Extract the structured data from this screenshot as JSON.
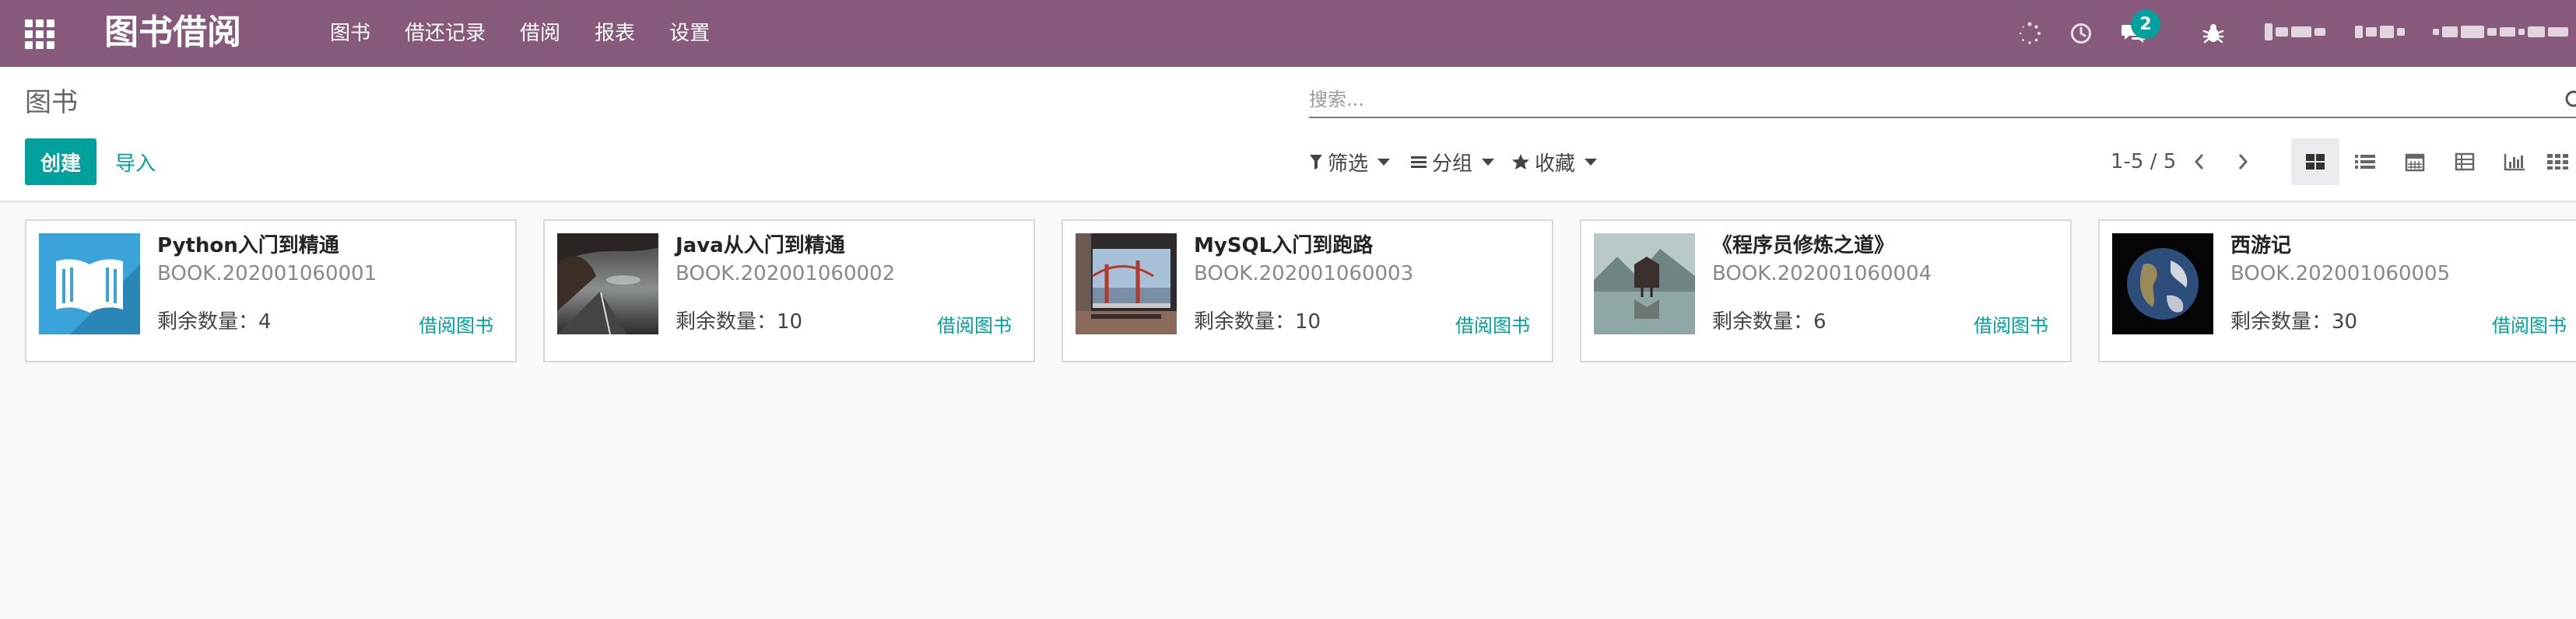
{
  "app": {
    "title": "图书借阅"
  },
  "menu": [
    "图书",
    "借还记录",
    "借阅",
    "报表",
    "设置"
  ],
  "systray": {
    "message_count": "2"
  },
  "breadcrumb": "图书",
  "buttons": {
    "create": "创建",
    "import": "导入"
  },
  "search": {
    "placeholder": "搜索..."
  },
  "filters": {
    "filter": "筛选",
    "group": "分组",
    "favorites": "收藏"
  },
  "pager": "1-5 / 5",
  "icons": {
    "apps": "apps-grid-icon",
    "activity": "clock-icon",
    "messaging": "comments-icon",
    "debug": "bug-icon",
    "loading": "spinner-icon",
    "filter": "funnel-icon",
    "group": "list-bars-icon",
    "favorites": "star-icon",
    "views": [
      "kanban-view-icon",
      "list-view-icon",
      "calendar-view-icon",
      "pivot-view-icon",
      "graph-view-icon",
      "grid-view-icon"
    ]
  },
  "colors": {
    "navbar": "#875a7b",
    "accent": "#00a09d",
    "page_bg": "#f9f9f9"
  },
  "books": [
    {
      "name": "Python入门到精通",
      "ref": "BOOK.202001060001",
      "stock_label": "剩余数量：",
      "stock": "4",
      "action": "借阅图书"
    },
    {
      "name": "Java从入门到精通",
      "ref": "BOOK.202001060002",
      "stock_label": "剩余数量：",
      "stock": "10",
      "action": "借阅图书"
    },
    {
      "name": "MySQL入门到跑路",
      "ref": "BOOK.202001060003",
      "stock_label": "剩余数量：",
      "stock": "10",
      "action": "借阅图书"
    },
    {
      "name": "《程序员修炼之道》",
      "ref": "BOOK.202001060004",
      "stock_label": "剩余数量：",
      "stock": "6",
      "action": "借阅图书"
    },
    {
      "name": "西游记",
      "ref": "BOOK.202001060005",
      "stock_label": "剩余数量：",
      "stock": "30",
      "action": "借阅图书"
    }
  ]
}
